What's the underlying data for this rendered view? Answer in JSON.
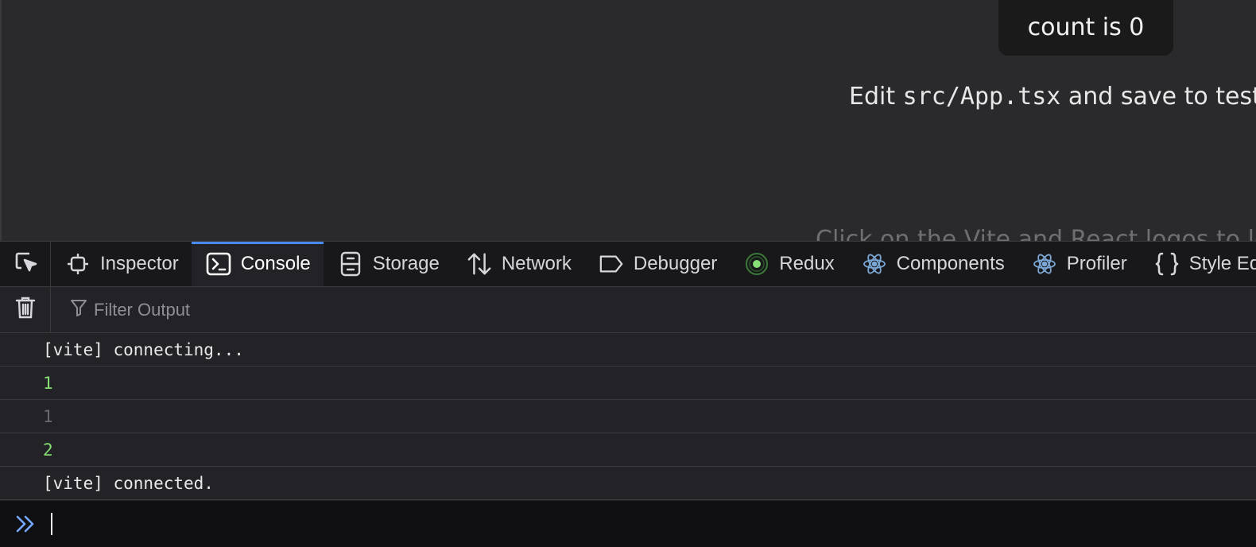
{
  "page": {
    "count_button_label": "count is 0",
    "edit_prefix": "Edit ",
    "edit_code": "src/App.tsx",
    "edit_suffix": " and save to test",
    "read_docs": "Click on the Vite and React logos to learn more"
  },
  "devtools": {
    "tabs": [
      {
        "label": "Inspector",
        "icon": "inspector-icon"
      },
      {
        "label": "Console",
        "icon": "console-icon",
        "active": true
      },
      {
        "label": "Storage",
        "icon": "storage-icon"
      },
      {
        "label": "Network",
        "icon": "network-icon"
      },
      {
        "label": "Debugger",
        "icon": "debugger-icon"
      },
      {
        "label": "Redux",
        "icon": "redux-icon"
      },
      {
        "label": "Components",
        "icon": "react-icon"
      },
      {
        "label": "Profiler",
        "icon": "react-icon"
      },
      {
        "label": "Style Editor",
        "icon": "braces-icon"
      }
    ],
    "filter_placeholder": "Filter Output",
    "messages": [
      {
        "text": "[vite] connecting...",
        "kind": "log"
      },
      {
        "text": "1",
        "kind": "number"
      },
      {
        "text": "1",
        "kind": "number-dim"
      },
      {
        "text": "2",
        "kind": "number"
      },
      {
        "text": "[vite] connected.",
        "kind": "log"
      }
    ],
    "input_value": ""
  },
  "colors": {
    "accent": "#4a8af0",
    "number": "#86de74",
    "react": "#7ca8d8",
    "redux_ring": "#3a7a3a"
  }
}
